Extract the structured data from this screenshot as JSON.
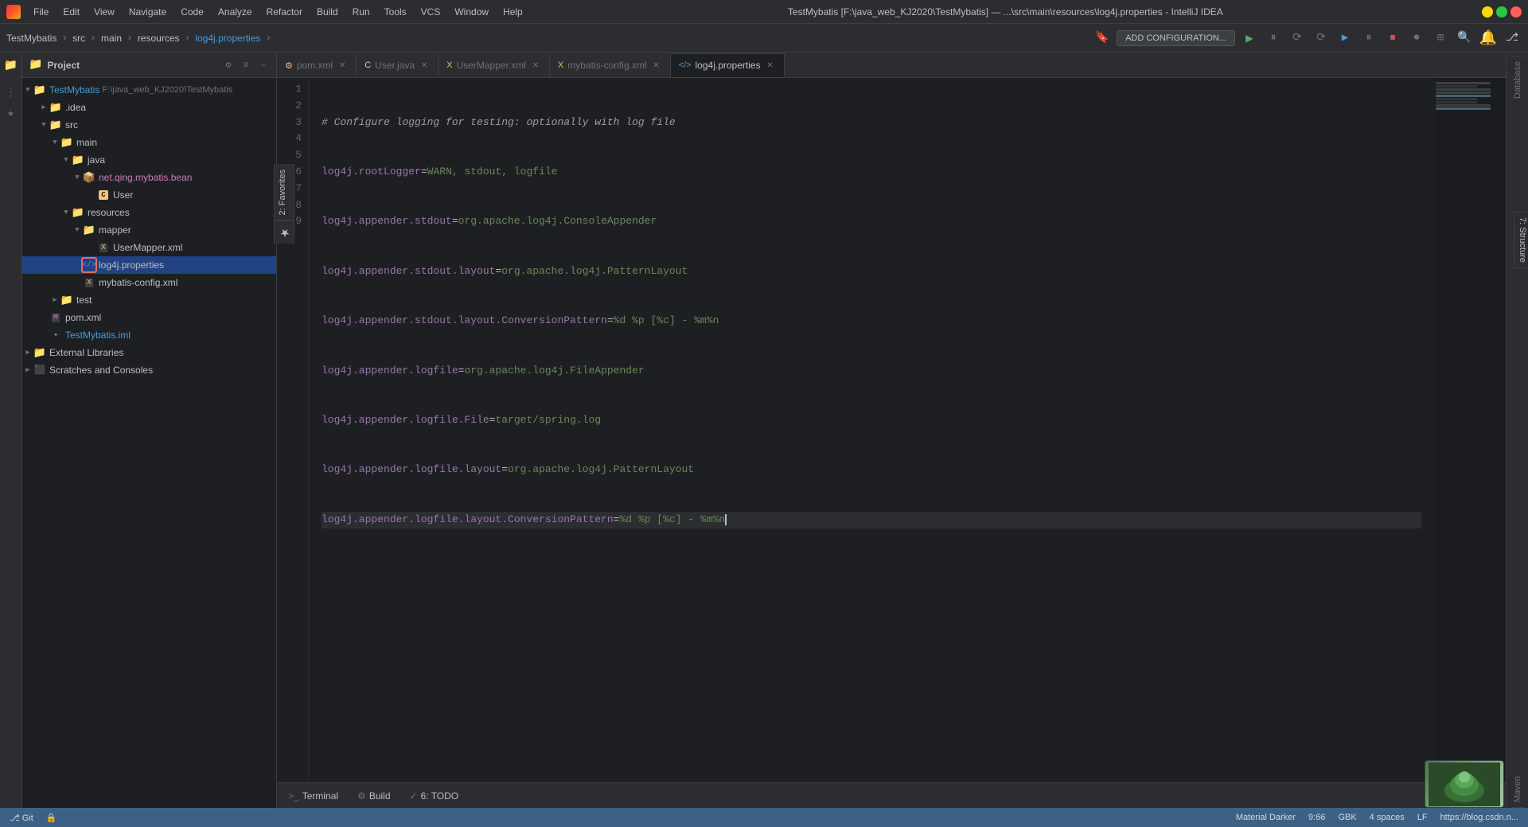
{
  "titleBar": {
    "title": "TestMybatis [F:\\java_web_KJ2020\\TestMybatis] — ...\\src\\main\\resources\\log4j.properties - IntelliJ IDEA",
    "windowControls": {
      "minimize": "—",
      "maximize": "⬜",
      "close": "✕"
    }
  },
  "menuBar": {
    "items": [
      "File",
      "Edit",
      "View",
      "Navigate",
      "Code",
      "Analyze",
      "Refactor",
      "Build",
      "Run",
      "Tools",
      "VCS",
      "Window",
      "Help"
    ]
  },
  "breadcrumb": {
    "items": [
      "TestMybatis",
      "src",
      "main",
      "resources",
      "log4j.properties"
    ]
  },
  "toolbar": {
    "addConfig": "ADD CONFIGURATION...",
    "icons": [
      "▶",
      "⏸",
      "⟳",
      "⟳",
      "⟳",
      "▶",
      "⏸",
      "⏹",
      "⏺",
      "≡",
      "🔍"
    ]
  },
  "projectPanel": {
    "title": "Project",
    "tree": [
      {
        "id": "testmybatis-root",
        "label": "TestMybatis",
        "path": "F:\\java_web_KJ2020\\TestMybatis",
        "indent": 0,
        "type": "project",
        "expanded": true
      },
      {
        "id": "idea",
        "label": ".idea",
        "indent": 1,
        "type": "folder",
        "expanded": false
      },
      {
        "id": "src",
        "label": "src",
        "indent": 1,
        "type": "folder-src",
        "expanded": true
      },
      {
        "id": "main",
        "label": "main",
        "indent": 2,
        "type": "folder",
        "expanded": true
      },
      {
        "id": "java",
        "label": "java",
        "indent": 3,
        "type": "folder-java",
        "expanded": true
      },
      {
        "id": "net-qing",
        "label": "net.qing.mybatis.bean",
        "indent": 4,
        "type": "package",
        "expanded": true
      },
      {
        "id": "user-class",
        "label": "User",
        "indent": 5,
        "type": "java-class"
      },
      {
        "id": "resources",
        "label": "resources",
        "indent": 3,
        "type": "folder-res",
        "expanded": true
      },
      {
        "id": "mapper",
        "label": "mapper",
        "indent": 4,
        "type": "folder",
        "expanded": true
      },
      {
        "id": "usermapper-xml",
        "label": "UserMapper.xml",
        "indent": 5,
        "type": "xml-mapper"
      },
      {
        "id": "log4j-props",
        "label": "log4j.properties",
        "indent": 4,
        "type": "properties-active",
        "active": true
      },
      {
        "id": "mybatis-config",
        "label": "mybatis-config.xml",
        "indent": 4,
        "type": "xml"
      },
      {
        "id": "test",
        "label": "test",
        "indent": 2,
        "type": "folder",
        "expanded": false
      },
      {
        "id": "pom-xml",
        "label": "pom.xml",
        "indent": 1,
        "type": "pom"
      },
      {
        "id": "testmybatis-iml",
        "label": "TestMybatis.iml",
        "indent": 1,
        "type": "iml"
      },
      {
        "id": "external-libs",
        "label": "External Libraries",
        "indent": 0,
        "type": "folder-ext",
        "expanded": false
      },
      {
        "id": "scratches",
        "label": "Scratches and Consoles",
        "indent": 0,
        "type": "scratches"
      }
    ]
  },
  "tabs": [
    {
      "id": "pom-xml",
      "label": "pom.xml",
      "type": "xml",
      "active": false
    },
    {
      "id": "user-java",
      "label": "User.java",
      "type": "java",
      "active": false
    },
    {
      "id": "usermapper-xml",
      "label": "UserMapper.xml",
      "type": "xml",
      "active": false
    },
    {
      "id": "mybatis-config-xml",
      "label": "mybatis-config.xml",
      "type": "xml",
      "active": false
    },
    {
      "id": "log4j-properties",
      "label": "log4j.properties",
      "type": "properties",
      "active": true
    }
  ],
  "editor": {
    "filename": "log4j.properties",
    "lines": [
      {
        "num": 1,
        "content": "# Configure logging for testing: optionally with log file",
        "type": "comment"
      },
      {
        "num": 2,
        "content": "log4j.rootLogger=WARN, stdout, logfile",
        "type": "property"
      },
      {
        "num": 3,
        "content": "log4j.appender.stdout=org.apache.log4j.ConsoleAppender",
        "type": "property"
      },
      {
        "num": 4,
        "content": "log4j.appender.stdout.layout=org.apache.log4j.PatternLayout",
        "type": "property"
      },
      {
        "num": 5,
        "content": "log4j.appender.stdout.layout.ConversionPattern=%d %p [%c] - %m%n",
        "type": "property"
      },
      {
        "num": 6,
        "content": "log4j.appender.logfile=org.apache.log4j.FileAppender",
        "type": "property"
      },
      {
        "num": 7,
        "content": "log4j.appender.logfile.File=target/spring.log",
        "type": "property"
      },
      {
        "num": 8,
        "content": "log4j.appender.logfile.layout=org.apache.log4j.PatternLayout",
        "type": "property"
      },
      {
        "num": 9,
        "content": "log4j.appender.logfile.layout.ConversionPattern=%d %p [%c] - %m%n",
        "type": "property",
        "cursor": true
      }
    ]
  },
  "bottomTabs": [
    {
      "id": "terminal",
      "label": "Terminal",
      "icon": ">_"
    },
    {
      "id": "build",
      "label": "Build",
      "icon": "⚙"
    },
    {
      "id": "todo",
      "label": "6: TODO",
      "icon": "✓"
    }
  ],
  "statusBar": {
    "left": [],
    "theme": "Material Darker",
    "position": "9:66",
    "encoding": "GBK",
    "indent": "4 spaces",
    "lf": "LF",
    "branch": "Git",
    "url": "https://blog.csdn.n...",
    "lock_icon": "🔒"
  },
  "verticalTabs": [
    {
      "id": "favorites",
      "label": "2: Favorites",
      "active": false
    },
    {
      "id": "star",
      "label": "★",
      "active": false
    }
  ],
  "structureTabs": [
    {
      "id": "structure",
      "label": "7: Structure",
      "active": false
    }
  ],
  "rightPanels": {
    "database": "Database",
    "maven": "Maven"
  }
}
